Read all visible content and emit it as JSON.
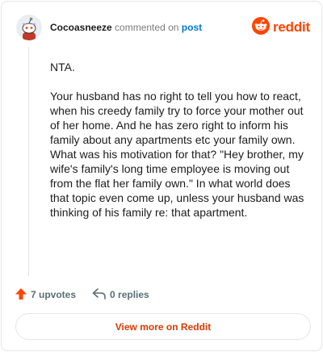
{
  "header": {
    "username": "Cocoasneeze",
    "action_text": "commented on",
    "post_link": "post",
    "brand_name": "reddit"
  },
  "comment": {
    "paragraphs": [
      "NTA.",
      "Your husband has no right to tell you how to react, when his creedy family try to force your mother out of her home. And he has zero right to inform his family about any apartments etc your family own. What was his motivation for that? \"Hey brother, my wife's family's long time employee is moving out from the flat her family own.\" In what world does that topic even come up, unless your husband was thinking of his family re: that apartment."
    ]
  },
  "actions": {
    "upvotes_label": "7 upvotes",
    "replies_label": "0 replies"
  },
  "footer": {
    "view_more_label": "View more on Reddit"
  },
  "colors": {
    "brand": "#ff4500",
    "link": "#0079d3",
    "button_text": "#d93a00",
    "muted": "#576f76"
  },
  "icons": {
    "avatar": "snoo-avatar",
    "brand": "reddit-logo-icon",
    "upvote": "upvote-arrow-icon",
    "reply": "reply-arrow-icon"
  }
}
